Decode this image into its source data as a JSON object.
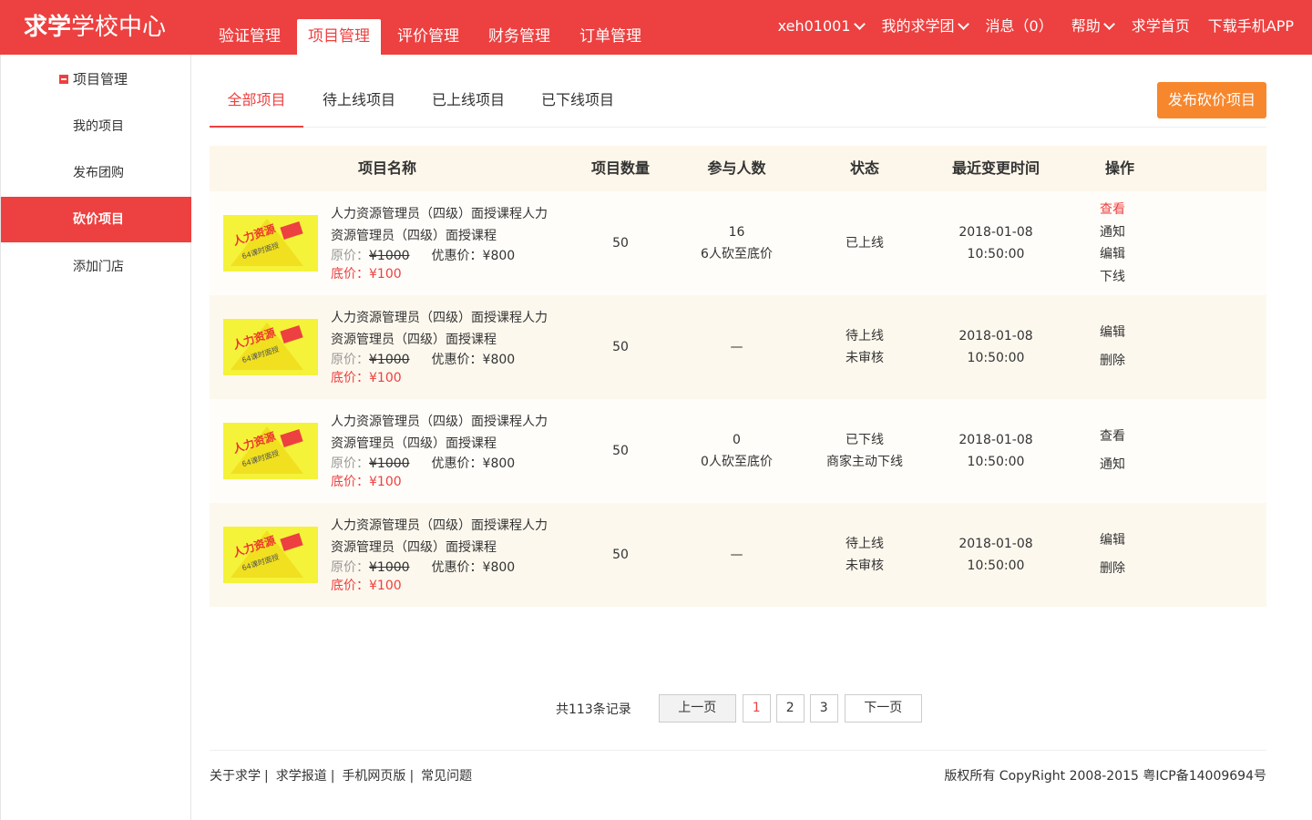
{
  "brand": {
    "logo_bold": "求学",
    "logo_rest": "学校中心"
  },
  "main_nav": [
    "验证管理",
    "项目管理",
    "评价管理",
    "财务管理",
    "订单管理"
  ],
  "user_nav": {
    "username": "xeh01001",
    "group": "我的求学团",
    "messages": "消息（0）",
    "help": "帮助",
    "home": "求学首页",
    "app": "下载手机APP"
  },
  "sidebar": {
    "section_title": "项目管理",
    "items": [
      "我的项目",
      "发布团购",
      "砍价项目",
      "添加门店"
    ]
  },
  "tabs": [
    "全部项目",
    "待上线项目",
    "已上线项目",
    "已下线项目"
  ],
  "publish_button": "发布砍价项目",
  "table": {
    "headers": [
      "项目名称",
      "项目数量",
      "参与人数",
      "状态",
      "最近变更时间",
      "操作"
    ],
    "rows": [
      {
        "name": "人力资源管理员（四级）面授课程人力资源管理员（四级）面授课程",
        "orig_label": "原价：",
        "orig_price": "¥1000",
        "disc": "优惠价：¥800",
        "floor": "底价：¥100",
        "qty": "50",
        "participants": "16",
        "participants_note": "6人砍至底价",
        "status": "已上线",
        "status_note": "",
        "date": "2018-01-08",
        "time": "10:50:00",
        "ops": [
          "查看",
          "通知",
          "编辑",
          "下线"
        ]
      },
      {
        "name": "人力资源管理员（四级）面授课程人力资源管理员（四级）面授课程",
        "orig_label": "原价：",
        "orig_price": "¥1000",
        "disc": "优惠价：¥800",
        "floor": "底价：¥100",
        "qty": "50",
        "participants": "—",
        "participants_note": "",
        "status": "待上线",
        "status_note": "未审核",
        "date": "2018-01-08",
        "time": "10:50:00",
        "ops": [
          "编辑",
          "删除"
        ]
      },
      {
        "name": "人力资源管理员（四级）面授课程人力资源管理员（四级）面授课程",
        "orig_label": "原价：",
        "orig_price": "¥1000",
        "disc": "优惠价：¥800",
        "floor": "底价：¥100",
        "qty": "50",
        "participants": "0",
        "participants_note": "0人砍至底价",
        "status": "已下线",
        "status_note": "商家主动下线",
        "date": "2018-01-08",
        "time": "10:50:00",
        "ops": [
          "查看",
          "通知"
        ]
      },
      {
        "name": "人力资源管理员（四级）面授课程人力资源管理员（四级）面授课程",
        "orig_label": "原价：",
        "orig_price": "¥1000",
        "disc": "优惠价：¥800",
        "floor": "底价：¥100",
        "qty": "50",
        "participants": "—",
        "participants_note": "",
        "status": "待上线",
        "status_note": "未审核",
        "date": "2018-01-08",
        "time": "10:50:00",
        "ops": [
          "编辑",
          "删除"
        ]
      }
    ],
    "thumb_text": {
      "main": "人力资源",
      "sub": "64课时面授"
    }
  },
  "pagination": {
    "total": "共113条记录",
    "prev": "上一页",
    "pages": [
      "1",
      "2",
      "3"
    ],
    "current": "1",
    "next": "下一页"
  },
  "footer": {
    "links": [
      "关于求学",
      "求学报道",
      "手机网页版",
      "常见问题"
    ],
    "separator": "|",
    "copyright": "版权所有 CopyRight 2008-2015 粤ICP备14009694号"
  },
  "colors": {
    "primary": "#ed4040",
    "accent": "#f7872d",
    "header_bg": "#fdf6ea"
  }
}
